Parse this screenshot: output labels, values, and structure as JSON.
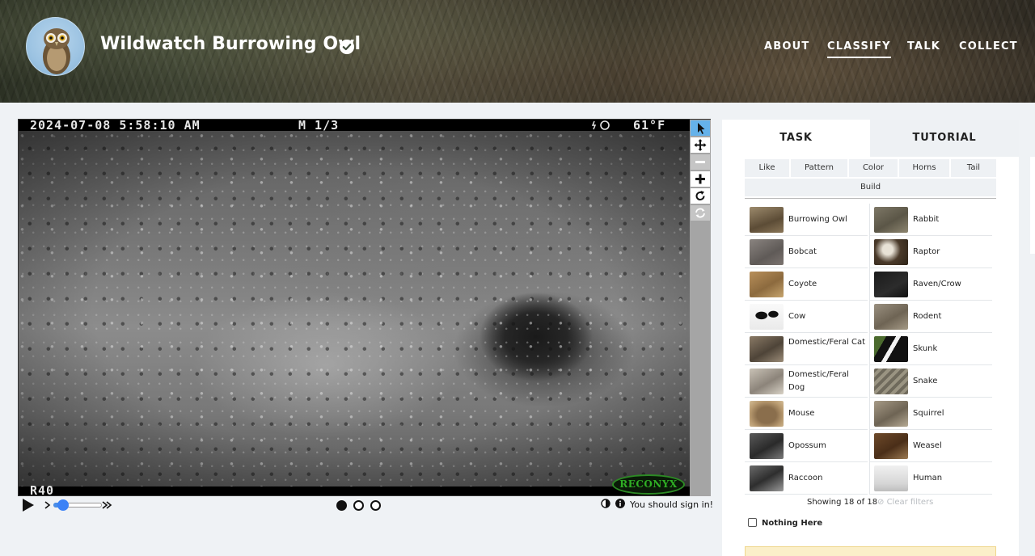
{
  "header": {
    "project_title": "Wildwatch Burrowing Owl",
    "nav": [
      "ABOUT",
      "CLASSIFY",
      "TALK",
      "COLLECT"
    ],
    "active_nav": "CLASSIFY"
  },
  "viewer": {
    "timestamp": "2024-07-08 5:58:10 AM",
    "sequence": "M 1/3",
    "temperature": "61°F",
    "camera_model": "R40",
    "brand": "RECONYX",
    "frames_total": 3,
    "current_frame": 1,
    "signin_message": "You should sign in!"
  },
  "task_panel": {
    "tabs": [
      "TASK",
      "TUTORIAL"
    ],
    "filters": [
      "Like",
      "Pattern",
      "Color",
      "Horns",
      "Tail",
      "Build"
    ],
    "choices": [
      [
        "Burrowing Owl",
        "Rabbit"
      ],
      [
        "Bobcat",
        "Raptor"
      ],
      [
        "Coyote",
        "Raven/Crow"
      ],
      [
        "Cow",
        "Rodent"
      ],
      [
        "Domestic/Feral Cat",
        "Skunk"
      ],
      [
        "Domestic/Feral Dog",
        "Snake"
      ],
      [
        "Mouse",
        "Squirrel"
      ],
      [
        "Opossum",
        "Weasel"
      ],
      [
        "Raccoon",
        "Human"
      ]
    ],
    "showing": "Showing 18 of 18",
    "clear_filters": "Clear filters",
    "nothing_here": "Nothing Here"
  },
  "colors": {
    "accent_blue": "#3b82f6",
    "active_tool": "#65b2ea",
    "reconyx_green": "#2fae24"
  }
}
